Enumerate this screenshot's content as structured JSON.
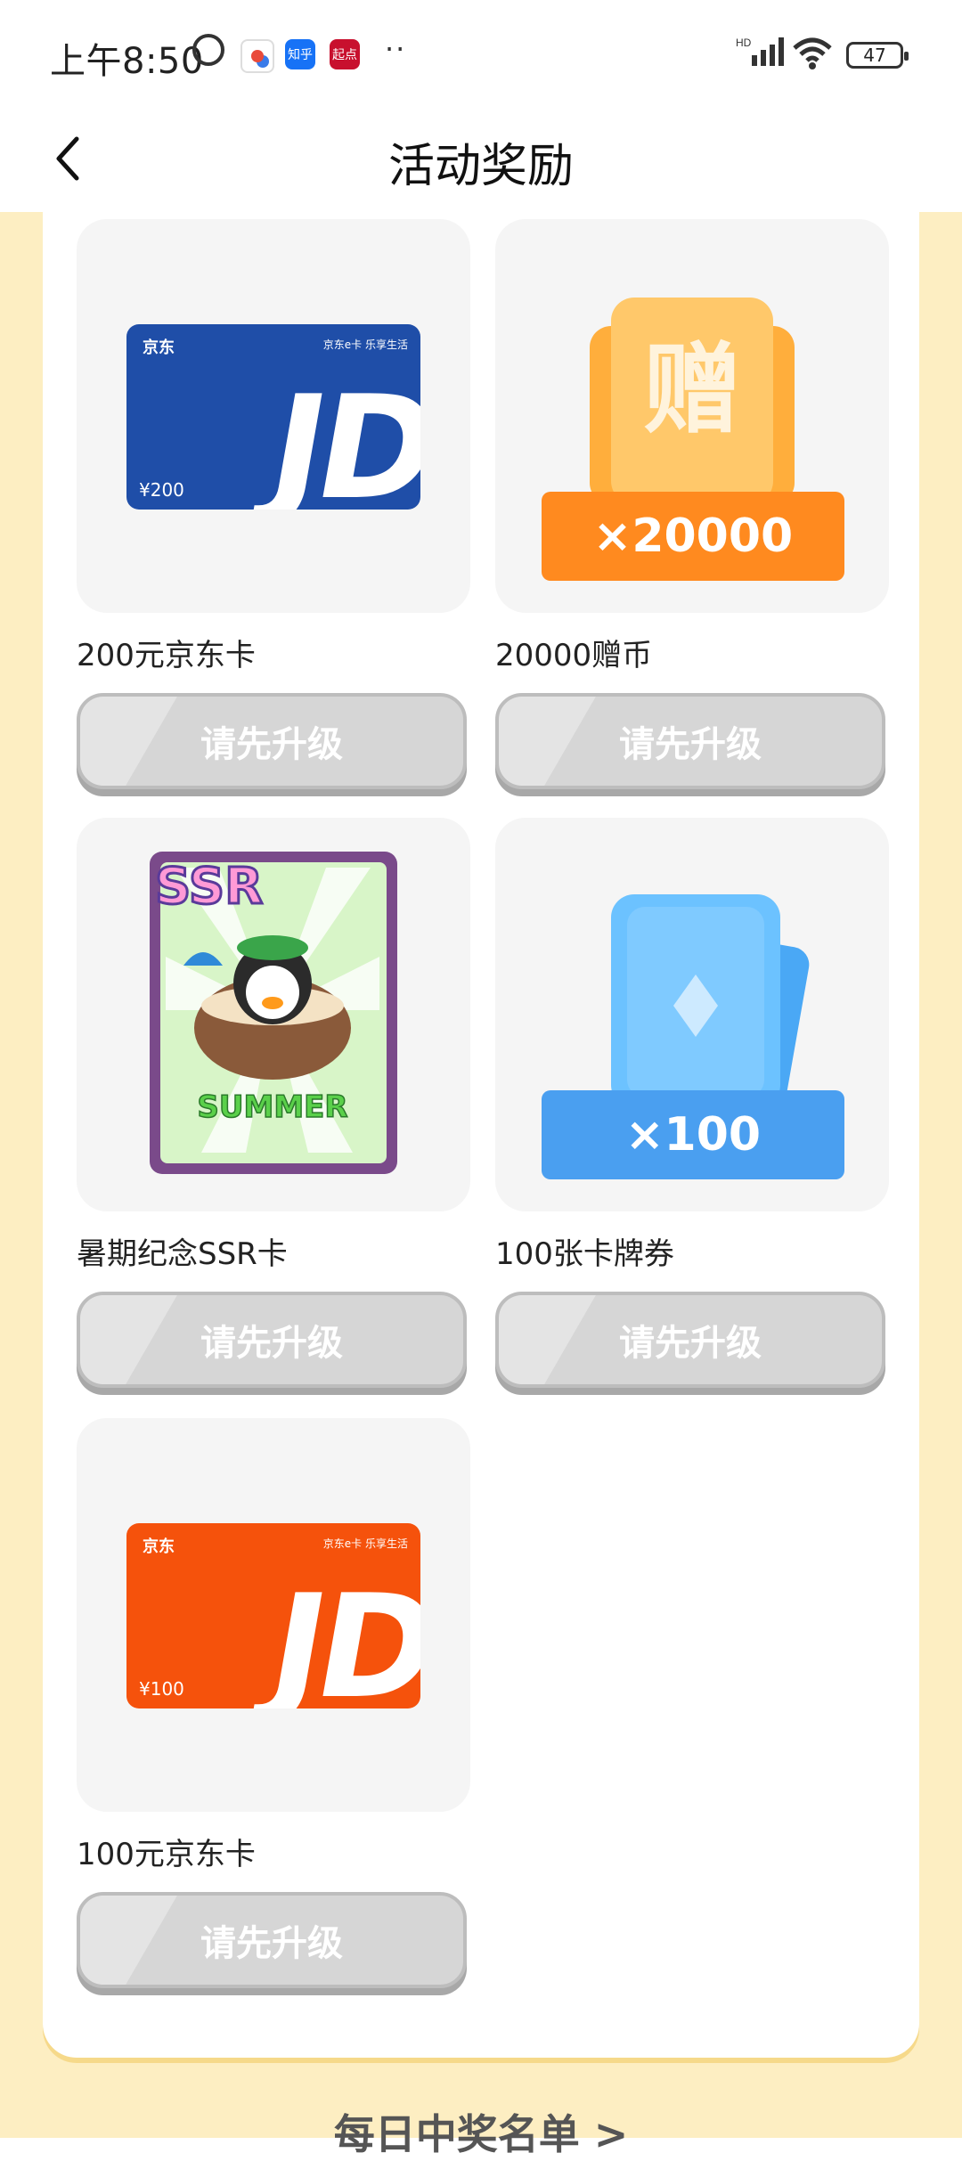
{
  "status_bar": {
    "time": "上午8:50",
    "apps": [
      {
        "name": "app-icon-1",
        "color": "#ffffff",
        "label": ""
      },
      {
        "name": "zhihu-icon",
        "color": "#1772f6",
        "label": "知乎"
      },
      {
        "name": "qidian-icon",
        "color": "#c8102e",
        "label": "起点"
      }
    ],
    "more": "··",
    "network": "HD",
    "battery": "47"
  },
  "header": {
    "title": "活动奖励"
  },
  "rewards": [
    {
      "name": "200元京东卡",
      "button": "请先升级",
      "card_amount": "¥200",
      "brand": "京东",
      "sub_brand": "京东e卡 乐享生活",
      "color": "#1f4ea8"
    },
    {
      "name": "20000赠币",
      "button": "请先升级",
      "badge": "×20000",
      "glyph": "赠",
      "color": "#ff8a1f"
    },
    {
      "name": "暑期纪念SSR卡",
      "button": "请先升级",
      "ssr": "SSR",
      "summer": "SUMMER"
    },
    {
      "name": "100张卡牌券",
      "button": "请先升级",
      "badge": "×100",
      "color": "#4a9ff0"
    },
    {
      "name": "100元京东卡",
      "button": "请先升级",
      "card_amount": "¥100",
      "brand": "京东",
      "sub_brand": "京东e卡 乐享生活",
      "color": "#f5520c"
    }
  ],
  "jd_logo": "JD",
  "footer": {
    "link": "每日中奖名单 >"
  }
}
